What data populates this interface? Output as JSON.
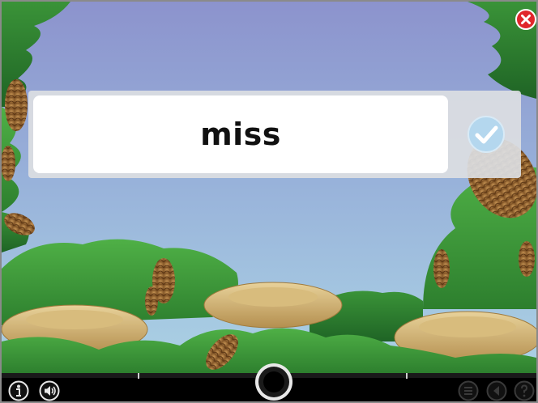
{
  "word": {
    "text": "miss"
  },
  "icons": {
    "close": "close-icon",
    "check": "checkmark-icon",
    "info": "info-icon",
    "sound": "speaker-icon",
    "record": "record-icon",
    "list": "list-icon",
    "previous": "previous-icon",
    "help": "help-icon"
  },
  "colors": {
    "sky_top": "#8f97cf",
    "sky_bottom": "#a9cfe3",
    "foliage": "#3f9a3a",
    "close_red": "#e0262b",
    "check_blue": "#b4d7ee"
  }
}
